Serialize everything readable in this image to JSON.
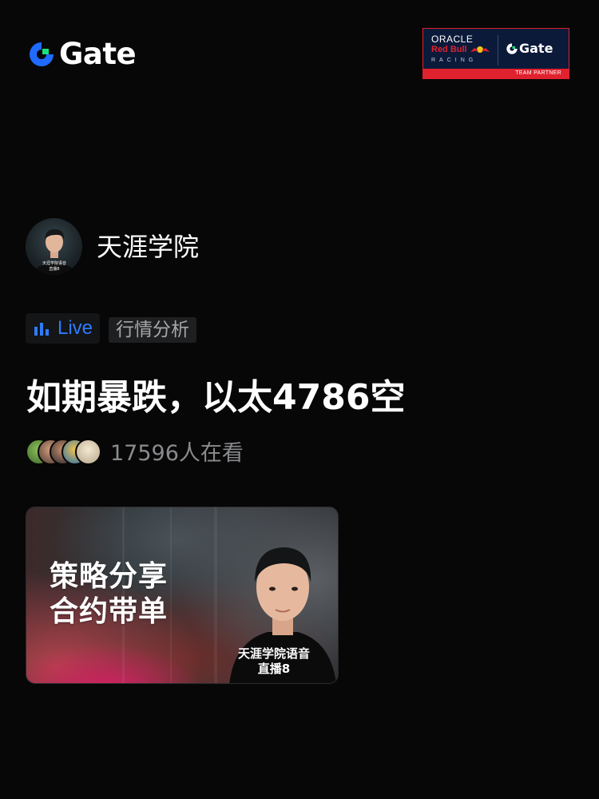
{
  "brand": {
    "name": "Gate",
    "icon": "gate-logo-icon",
    "accent": "#17e07c",
    "primary_blue": "#1f6bff"
  },
  "partner_badge": {
    "oracle": "ORACLE",
    "red_bull": "Red Bull",
    "racing": "RACING",
    "gate": "Gate",
    "team_partner": "TEAM PARTNER",
    "bg_color": "#0c1a3a",
    "accent_color": "#e0212e"
  },
  "host": {
    "name": "天涯学院",
    "avatar_caption_line1": "天涯学院语音",
    "avatar_caption_line2": "直播8"
  },
  "tags": {
    "live_icon": "live-bars-icon",
    "live_label": "Live",
    "live_color": "#2f7bff",
    "category": "行情分析"
  },
  "stream": {
    "title": "如期暴跌，以太4786空",
    "viewer_count_text": "17596人在看"
  },
  "cover": {
    "line1": "策略分享",
    "line2": "合约带单",
    "caption_line1": "天涯学院语音",
    "caption_line2": "直播8"
  }
}
